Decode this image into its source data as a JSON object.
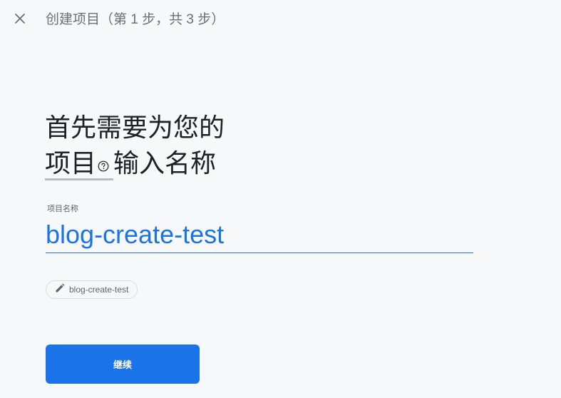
{
  "header": {
    "title": "创建项目（第 1 步，共 3 步）",
    "close_icon": "close-icon"
  },
  "heading": {
    "line1": "首先需要为您的",
    "term": "项目",
    "line2_rest": "输入名称",
    "help_icon": "help-circle-icon"
  },
  "form": {
    "project_name_label": "项目名称",
    "project_name_value": "blog-create-test",
    "project_id_chip": "blog-create-test",
    "edit_icon": "pencil-icon"
  },
  "actions": {
    "continue_label": "继续"
  },
  "colors": {
    "accent": "#1a73e8",
    "background": "#f7f8fa",
    "text": "#202124",
    "muted": "#5f6368"
  }
}
